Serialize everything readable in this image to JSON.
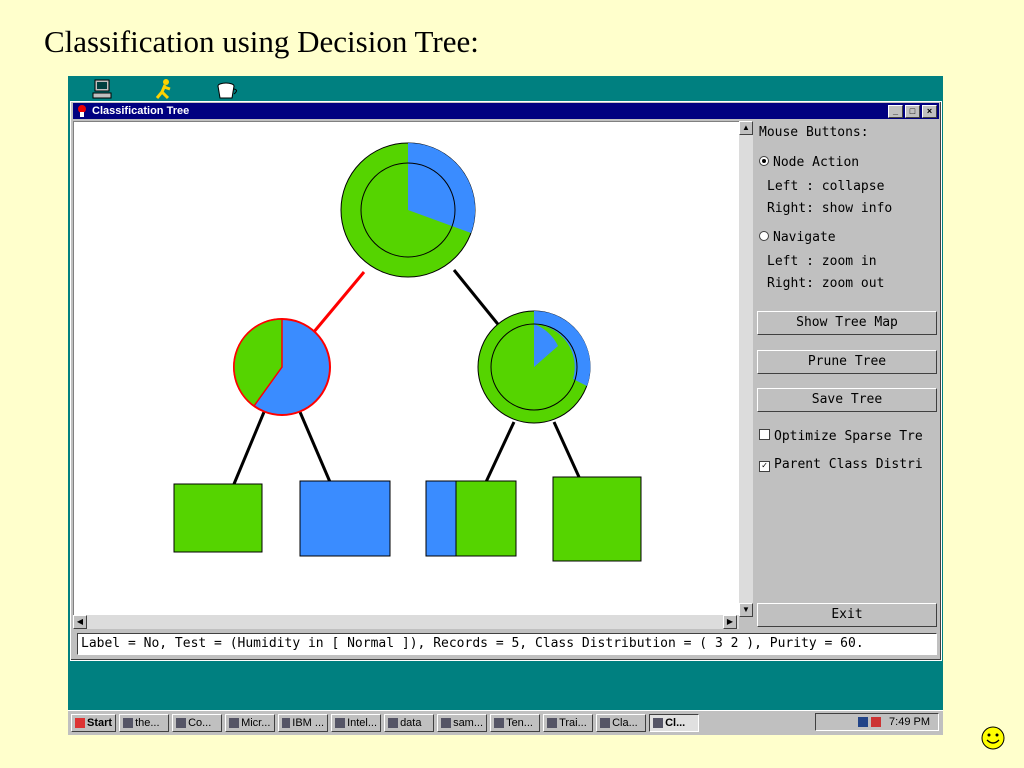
{
  "slide": {
    "title": "Classification using Decision Tree:"
  },
  "window": {
    "title": "Classification Tree"
  },
  "panel": {
    "mouse_buttons": "Mouse Buttons:",
    "node_action": "Node Action",
    "node_left": "Left : collapse",
    "node_right": "Right: show info",
    "navigate": "Navigate",
    "nav_left": "Left : zoom in",
    "nav_right": "Right: zoom out",
    "show_tree_map": "Show Tree Map",
    "prune_tree": "Prune Tree",
    "save_tree": "Save Tree",
    "optimize_sparse": "Optimize Sparse Tre",
    "parent_class": "Parent Class Distri",
    "exit": "Exit",
    "selected_mode": "Node Action",
    "optimize_checked": false,
    "parent_class_checked": true
  },
  "status": "Label = No, Test = (Humidity in [ Normal ]), Records = 5, Class Distribution = ( 3 2 ), Purity = 60.",
  "colors": {
    "class_a": "#55d400",
    "class_b": "#3a8cff",
    "selected_edge": "#ff0000"
  },
  "taskbar": {
    "start": "Start",
    "items": [
      "the...",
      "Co...",
      "Micr...",
      "IBM ...",
      "Intel...",
      "data",
      "sam...",
      "Ten...",
      "Trai...",
      "Cla...",
      "Cl..."
    ],
    "clock": "7:49 PM"
  }
}
